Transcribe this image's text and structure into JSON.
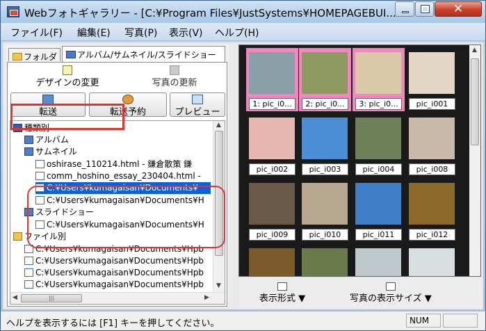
{
  "window": {
    "title": "Webフォトギャラリー - [C:¥Program Files¥JustSystems¥HOMEPAGEBUI..."
  },
  "menu": [
    "ファイル(F)",
    "編集(E)",
    "写真(P)",
    "表示(V)",
    "ヘルプ(H)"
  ],
  "tabs": {
    "folder": "フォルダ",
    "album": "アルバム/サムネイル/スライドショー"
  },
  "buttons": {
    "design": "デザインの変更",
    "update": "写真の更新",
    "transfer": "転送",
    "schedule": "転送予約",
    "preview": "プレビュー"
  },
  "tree": [
    {
      "label": "種類別",
      "icon": "category-icon"
    },
    {
      "label": "アルバム",
      "icon": "album-icon"
    },
    {
      "label": "サムネイル",
      "icon": "thumbnail-icon"
    },
    {
      "label": "oshirase_110214.html - 鎌倉散策 鎌",
      "icon": "page-icon"
    },
    {
      "label": "comm_hoshino_essay_230404.html -",
      "icon": "page-icon"
    },
    {
      "label": "C:¥Users¥kumagaisan¥Documents¥",
      "icon": "page-icon"
    },
    {
      "label": "C:¥Users¥kumagaisan¥Documents¥H",
      "icon": "page-icon"
    },
    {
      "label": "スライドショー",
      "icon": "slideshow-icon"
    },
    {
      "label": "C:¥Users¥kumagaisan¥Documents¥H",
      "icon": "page-icon"
    },
    {
      "label": "ファイル別",
      "icon": "folder-icon"
    },
    {
      "label": "C:¥Users¥kumagaisan¥Documents¥Hpb",
      "icon": "page-icon"
    },
    {
      "label": "C:¥Users¥kumagaisan¥Documents¥Hpb",
      "icon": "page-icon"
    },
    {
      "label": "C:¥Users¥kumagaisan¥Documents¥Hpb",
      "icon": "page-icon"
    },
    {
      "label": "C:¥Users¥kumagaisan¥Documents¥Hpb",
      "icon": "page-icon"
    }
  ],
  "gallery": [
    {
      "label": "1: pic_i0...",
      "selected": true,
      "color": "#8aa0a8"
    },
    {
      "label": "2: pic_i0...",
      "selected": true,
      "color": "#8f9a60"
    },
    {
      "label": "3: pic_i0...",
      "selected": true,
      "color": "#d9c9a8"
    },
    {
      "label": "pic_i001",
      "selected": false,
      "color": "#e4d6c4"
    },
    {
      "label": "pic_i002",
      "selected": false,
      "color": "#e6b8b0"
    },
    {
      "label": "pic_i003",
      "selected": false,
      "color": "#4a8fd6"
    },
    {
      "label": "pic_i004",
      "selected": false,
      "color": "#6f7f5a"
    },
    {
      "label": "pic_i008",
      "selected": false,
      "color": "#c9b9a8"
    },
    {
      "label": "pic_i009",
      "selected": false,
      "color": "#6b5a47"
    },
    {
      "label": "pic_i010",
      "selected": false,
      "color": "#b9a890"
    },
    {
      "label": "pic_i011",
      "selected": false,
      "color": "#3f7fc8"
    },
    {
      "label": "pic_i012",
      "selected": false,
      "color": "#8c6a2a"
    },
    {
      "label": "",
      "selected": false,
      "color": "#7a5a2a"
    },
    {
      "label": "",
      "selected": false,
      "color": "#6a7a4a"
    },
    {
      "label": "",
      "selected": false,
      "color": "#bfc8cc"
    },
    {
      "label": "",
      "selected": false,
      "color": "#d8dde0"
    }
  ],
  "bottom": {
    "display_format": "表示形式",
    "display_size": "写真の表示サイズ"
  },
  "status": {
    "text": "ヘルプを表示するには [F1] キーを押してください。",
    "num": "NUM"
  }
}
